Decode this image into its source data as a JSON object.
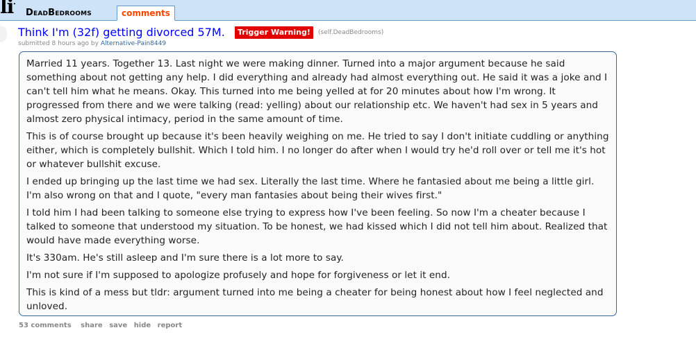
{
  "header": {
    "logo_text": "lit",
    "subreddit": "DeadBedrooms",
    "active_tab": "comments"
  },
  "post": {
    "title": "Think I'm (32f) getting divorced 57M.",
    "flair": "Trigger Warning!",
    "domain": "(self.DeadBedrooms)",
    "submitted_prefix": "submitted 8 hours ago by",
    "author": "Alternative-Pain8449",
    "paragraphs": [
      "Married 11 years. Together 13. Last night we were making dinner. Turned into a major argument because he said something about not getting any help. I did everything and already had almost everything out. He said it was a joke and I can't tell him what he means. Okay. This turned into me being yelled at for 20 minutes about how I'm wrong. It progressed from there and we were talking (read: yelling) about our relationship etc. We haven't had sex in 5 years and almost zero physical intimacy, period in the same amount of time.",
      "This is of course brought up because it's been heavily weighing on me. He tried to say I don't initiate cuddling or anything either, which is completely bullshit. Which I told him. I no longer do after when I would try he'd roll over or tell me it's hot or whatever bullshit excuse.",
      "I ended up bringing up the last time we had sex. Literally the last time. Where he fantasied about me being a little girl. I'm also wrong on that and I quote, \"every man fantasies about being their wives first.\"",
      "I told him I had been talking to someone else trying to express how I've been feeling. So now I'm a cheater because I talked to someone that understood my situation. To be honest, we had kissed which I did not tell him about. Realized that would have made everything worse.",
      "It's 330am. He's still asleep and I'm sure there is a lot more to say.",
      "I'm not sure if I'm supposed to apologize profusely and hope for forgiveness or let it end.",
      "This is kind of a mess but tldr: argument turned into me being a cheater for being honest about how I feel neglected and unloved."
    ]
  },
  "actions": {
    "comments": "53 comments",
    "share": "share",
    "save": "save",
    "hide": "hide",
    "report": "report"
  },
  "colors": {
    "header_bg": "#cee3f8",
    "title_link": "#0000ff",
    "flair_bg": "#e30000",
    "tab_text": "#ff4500",
    "box_border": "#336699"
  }
}
